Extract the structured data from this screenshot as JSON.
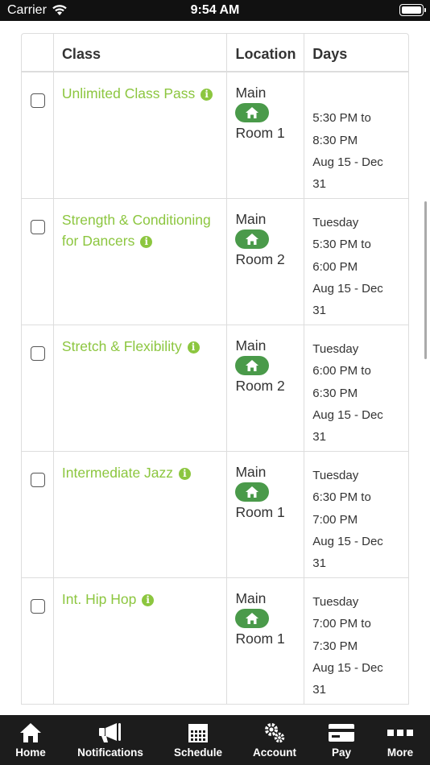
{
  "status_bar": {
    "carrier": "Carrier",
    "time": "9:54 AM"
  },
  "table": {
    "headers": {
      "class": "Class",
      "location": "Location",
      "days": "Days"
    },
    "rows": [
      {
        "class_name": "Unlimited Class Pass",
        "location_top": "Main",
        "location_bottom": "Room 1",
        "days": [
          "",
          "5:30 PM to",
          "8:30 PM",
          "Aug 15 - Dec",
          "31"
        ]
      },
      {
        "class_name": "Strength & Conditioning for Dancers",
        "location_top": "Main",
        "location_bottom": "Room 2",
        "days": [
          "Tuesday",
          "5:30 PM to",
          "6:00 PM",
          "Aug 15 - Dec",
          "31"
        ]
      },
      {
        "class_name": "Stretch & Flexibility",
        "location_top": "Main",
        "location_bottom": "Room 2",
        "days": [
          "Tuesday",
          "6:00 PM to",
          "6:30 PM",
          "Aug 15 - Dec",
          "31"
        ]
      },
      {
        "class_name": "Intermediate Jazz",
        "location_top": "Main",
        "location_bottom": "Room 1",
        "days": [
          "Tuesday",
          "6:30 PM to",
          "7:00 PM",
          "Aug 15 - Dec",
          "31"
        ]
      },
      {
        "class_name": "Int. Hip Hop",
        "location_top": "Main",
        "location_bottom": "Room 1",
        "days": [
          "Tuesday",
          "7:00 PM to",
          "7:30 PM",
          "Aug 15 - Dec",
          "31"
        ]
      }
    ]
  },
  "tab_bar": {
    "items": [
      {
        "label": "Home",
        "icon": "home-icon"
      },
      {
        "label": "Notifications",
        "icon": "megaphone-icon"
      },
      {
        "label": "Schedule",
        "icon": "calendar-icon"
      },
      {
        "label": "Account",
        "icon": "gears-icon"
      },
      {
        "label": "Pay",
        "icon": "credit-card-icon"
      },
      {
        "label": "More",
        "icon": "more-icon"
      }
    ]
  },
  "colors": {
    "class_link": "#8cc63f",
    "location_badge": "#4a9a4a",
    "tab_bar": "#1c1c1c"
  }
}
